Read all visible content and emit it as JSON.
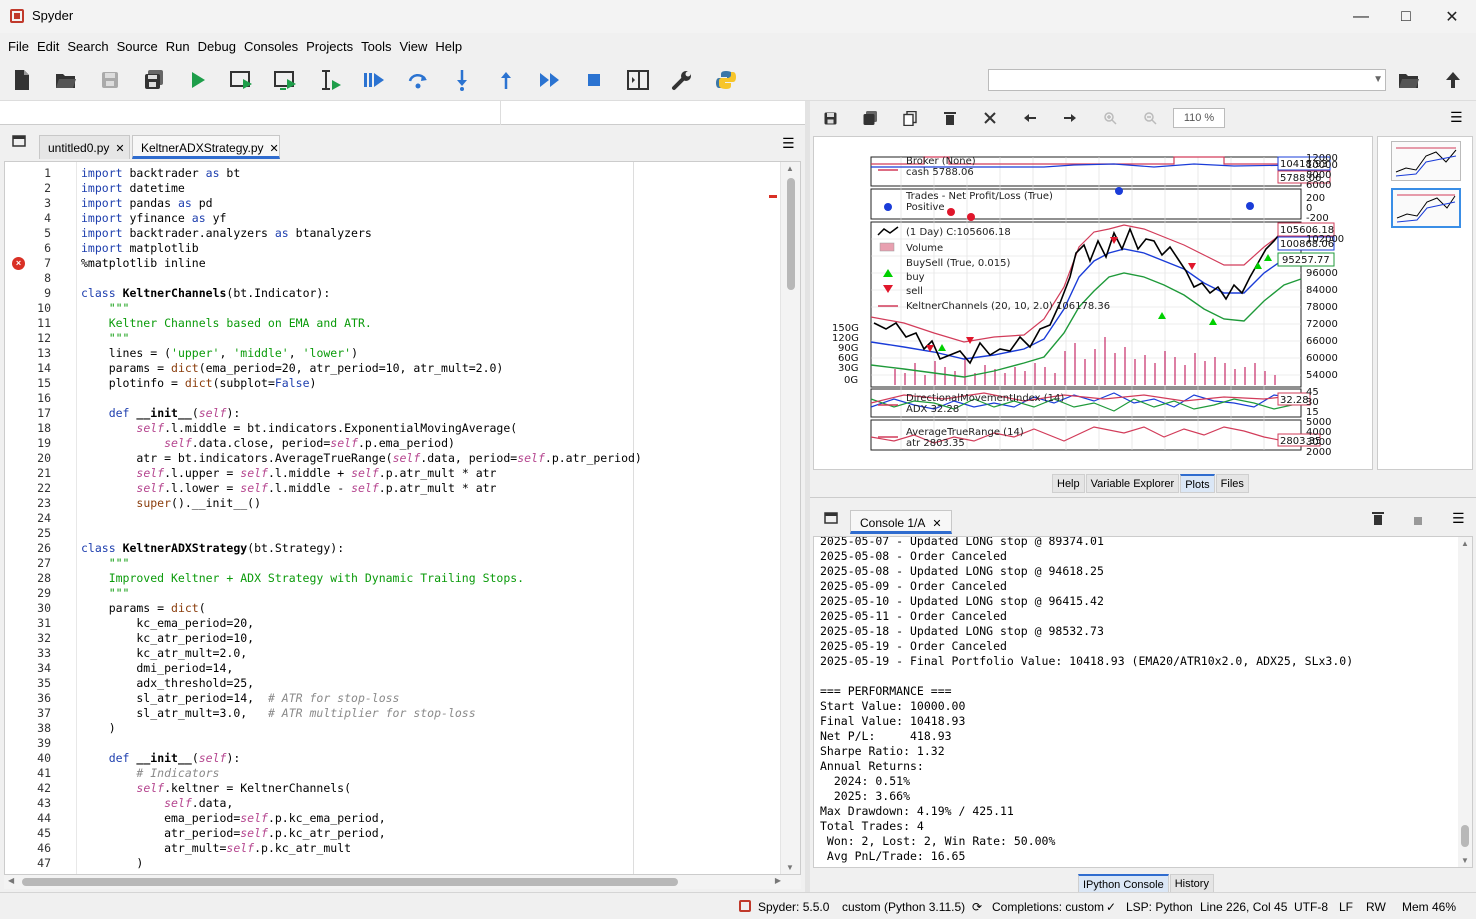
{
  "window": {
    "title": "Spyder"
  },
  "menu": [
    "File",
    "Edit",
    "Search",
    "Source",
    "Run",
    "Debug",
    "Consoles",
    "Projects",
    "Tools",
    "View",
    "Help"
  ],
  "editor": {
    "tabs": [
      {
        "label": "untitled0.py",
        "active": false
      },
      {
        "label": "KeltnerADXStrategy.py",
        "active": true
      }
    ],
    "error_line": 7,
    "lines": [
      "import backtrader as bt",
      "import datetime",
      "import pandas as pd",
      "import yfinance as yf",
      "import backtrader.analyzers as btanalyzers",
      "import matplotlib",
      "%matplotlib inline",
      "",
      "class KeltnerChannels(bt.Indicator):",
      "    \"\"\"",
      "    Keltner Channels based on EMA and ATR.",
      "    \"\"\"",
      "    lines = ('upper', 'middle', 'lower')",
      "    params = dict(ema_period=20, atr_period=10, atr_mult=2.0)",
      "    plotinfo = dict(subplot=False)",
      "",
      "    def __init__(self):",
      "        self.l.middle = bt.indicators.ExponentialMovingAverage(",
      "            self.data.close, period=self.p.ema_period)",
      "        atr = bt.indicators.AverageTrueRange(self.data, period=self.p.atr_period)",
      "        self.l.upper = self.l.middle + self.p.atr_mult * atr",
      "        self.l.lower = self.l.middle - self.p.atr_mult * atr",
      "        super().__init__()",
      "",
      "",
      "class KeltnerADXStrategy(bt.Strategy):",
      "    \"\"\"",
      "    Improved Keltner + ADX Strategy with Dynamic Trailing Stops.",
      "    \"\"\"",
      "    params = dict(",
      "        kc_ema_period=20,",
      "        kc_atr_period=10,",
      "        kc_atr_mult=2.0,",
      "        dmi_period=14,",
      "        adx_threshold=25,",
      "        sl_atr_period=14,  # ATR for stop-loss",
      "        sl_atr_mult=3.0,   # ATR multiplier for stop-loss",
      "    )",
      "",
      "    def __init__(self):",
      "        # Indicators",
      "        self.keltner = KeltnerChannels(",
      "            self.data,",
      "            ema_period=self.p.kc_ema_period,",
      "            atr_period=self.p.kc_atr_period,",
      "            atr_mult=self.p.kc_atr_mult",
      "        )"
    ]
  },
  "plots": {
    "zoom": "110 %",
    "bottom_tabs": [
      "Help",
      "Variable Explorer",
      "Plots",
      "Files"
    ],
    "active_tab": "Plots",
    "legend": {
      "broker": "Broker (None)",
      "cash": "cash 5788.06",
      "trades": "Trades - Net Profit/Loss (True)",
      "positive": "Positive",
      "price": "(1 Day) C:105606.18",
      "volume": "Volume",
      "buysell": "BuySell (True, 0.015)",
      "buy": "buy",
      "sell": "sell",
      "keltner": "KeltnerChannels (20, 10, 2.0) 106178.36",
      "dmi": "DirectionalMovementIndex (14)",
      "adx": "ADX 32.28",
      "atr_title": "AverageTrueRange (14)",
      "atr": "atr 2803.35"
    },
    "value_boxes": [
      "10418.93",
      "5788.06",
      "105606.18",
      "100868.06",
      "95257.77",
      "32.28",
      "2803.35"
    ],
    "broker_ticks": [
      "12000",
      "10000",
      "8000",
      "6000"
    ],
    "trade_ticks": [
      "200",
      "0",
      "-200"
    ],
    "price_ticks": [
      "102000",
      "96000",
      "90000",
      "84000",
      "78000",
      "72000",
      "66000",
      "60000",
      "54000"
    ],
    "volume_ticks": [
      "150G",
      "120G",
      "90G",
      "60G",
      "30G",
      "0G"
    ],
    "dmi_ticks": [
      "45",
      "30",
      "15"
    ],
    "atr_ticks": [
      "5000",
      "4000",
      "3000",
      "2000"
    ]
  },
  "console": {
    "tab_label": "Console 1/A",
    "bottom_tabs": [
      "IPython Console",
      "History"
    ],
    "active_tab": "IPython Console",
    "lines": [
      "2025-05-07 - Updated LONG stop @ 89374.01",
      "2025-05-08 - Order Canceled",
      "2025-05-08 - Updated LONG stop @ 94618.25",
      "2025-05-09 - Order Canceled",
      "2025-05-10 - Updated LONG stop @ 96415.42",
      "2025-05-11 - Order Canceled",
      "2025-05-18 - Updated LONG stop @ 98532.73",
      "2025-05-19 - Order Canceled",
      "2025-05-19 - Final Portfolio Value: 10418.93 (EMA20/ATR10x2.0, ADX25, SLx3.0)",
      "",
      "=== PERFORMANCE ===",
      "Start Value: 10000.00",
      "Final Value: 10418.93",
      "Net P/L:     418.93",
      "Sharpe Ratio: 1.32",
      "Annual Returns:",
      "  2024: 0.51%",
      "  2025: 3.66%",
      "Max Drawdown: 4.19% / 425.11",
      "Total Trades: 4",
      " Won: 2, Lost: 2, Win Rate: 50.00%",
      " Avg PnL/Trade: 16.65"
    ]
  },
  "status": {
    "spyder": "Spyder: 5.5.0",
    "env": "custom (Python 3.11.5)",
    "completions": "Completions: custom",
    "lsp": "LSP: Python",
    "position": "Line 226, Col 45",
    "encoding": "UTF-8",
    "eol": "LF",
    "rw": "RW",
    "mem": "Mem 46%"
  },
  "colors": {
    "accent": "#2f6ccf",
    "run_green": "#1e9e4a",
    "toolbar_blue": "#2b73d1",
    "error": "#d93025"
  }
}
